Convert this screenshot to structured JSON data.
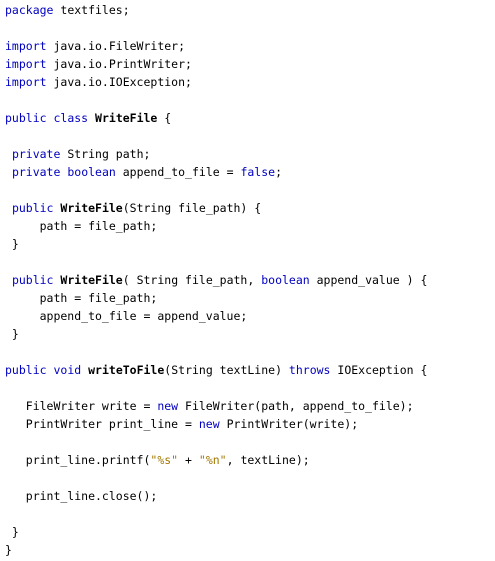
{
  "editor": {
    "language": "Java",
    "colors": {
      "keyword": "#0000c0",
      "string": "#a07800",
      "text": "#000000",
      "background": "#ffffff"
    },
    "lines": [
      [
        {
          "t": "package",
          "c": "kw"
        },
        {
          "t": " textfiles;"
        }
      ],
      [],
      [
        {
          "t": "import",
          "c": "kw"
        },
        {
          "t": " java.io.FileWriter;"
        }
      ],
      [
        {
          "t": "import",
          "c": "kw"
        },
        {
          "t": " java.io.PrintWriter;"
        }
      ],
      [
        {
          "t": "import",
          "c": "kw"
        },
        {
          "t": " java.io.IOException;"
        }
      ],
      [],
      [
        {
          "t": "public",
          "c": "kw"
        },
        {
          "t": " "
        },
        {
          "t": "class",
          "c": "kw"
        },
        {
          "t": " "
        },
        {
          "t": "WriteFile",
          "c": "bold"
        },
        {
          "t": " {"
        }
      ],
      [],
      [
        {
          "t": " "
        },
        {
          "t": "private",
          "c": "kw"
        },
        {
          "t": " String path;"
        }
      ],
      [
        {
          "t": " "
        },
        {
          "t": "private",
          "c": "kw"
        },
        {
          "t": " "
        },
        {
          "t": "boolean",
          "c": "kw"
        },
        {
          "t": " append_to_file = "
        },
        {
          "t": "false",
          "c": "kw"
        },
        {
          "t": ";"
        }
      ],
      [],
      [
        {
          "t": " "
        },
        {
          "t": "public",
          "c": "kw"
        },
        {
          "t": " "
        },
        {
          "t": "WriteFile",
          "c": "bold"
        },
        {
          "t": "(String file_path) {"
        }
      ],
      [
        {
          "t": "     path = file_path;"
        }
      ],
      [
        {
          "t": " }"
        }
      ],
      [],
      [
        {
          "t": " "
        },
        {
          "t": "public",
          "c": "kw"
        },
        {
          "t": " "
        },
        {
          "t": "WriteFile",
          "c": "bold"
        },
        {
          "t": "( String file_path, "
        },
        {
          "t": "boolean",
          "c": "kw"
        },
        {
          "t": " append_value ) {"
        }
      ],
      [
        {
          "t": "     path = file_path;"
        }
      ],
      [
        {
          "t": "     append_to_file = append_value;"
        }
      ],
      [
        {
          "t": " }"
        }
      ],
      [],
      [
        {
          "t": "public",
          "c": "kw"
        },
        {
          "t": " "
        },
        {
          "t": "void",
          "c": "kw"
        },
        {
          "t": " "
        },
        {
          "t": "writeToFile",
          "c": "bold"
        },
        {
          "t": "(String textLine) "
        },
        {
          "t": "throws",
          "c": "kw"
        },
        {
          "t": " IOException {"
        }
      ],
      [],
      [
        {
          "t": "   FileWriter write = "
        },
        {
          "t": "new",
          "c": "kw"
        },
        {
          "t": " FileWriter(path, append_to_file);"
        }
      ],
      [
        {
          "t": "   PrintWriter print_line = "
        },
        {
          "t": "new",
          "c": "kw"
        },
        {
          "t": " PrintWriter(write);"
        }
      ],
      [],
      [
        {
          "t": "   print_line.printf("
        },
        {
          "t": "\"%s\"",
          "c": "str"
        },
        {
          "t": " + "
        },
        {
          "t": "\"%n\"",
          "c": "str"
        },
        {
          "t": ", textLine);"
        }
      ],
      [],
      [
        {
          "t": "   print_line.close();"
        }
      ],
      [],
      [
        {
          "t": " }"
        }
      ],
      [
        {
          "t": "}"
        }
      ]
    ]
  }
}
